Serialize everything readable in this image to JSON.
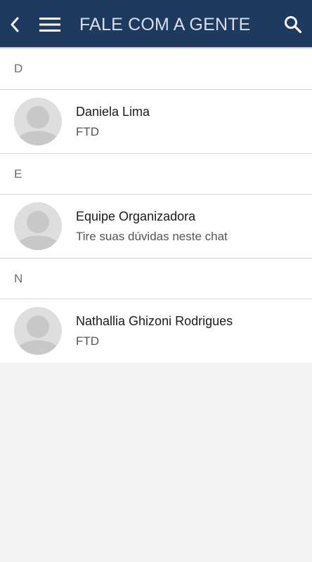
{
  "header": {
    "title": "FALE COM A GENTE",
    "back_icon": "chevron-left-icon",
    "menu_icon": "hamburger-menu-icon",
    "search_icon": "search-icon",
    "background_color": "#1e3a5f"
  },
  "sections": [
    {
      "letter": "D",
      "contacts": [
        {
          "name": "Daniela Lima",
          "subtitle": "FTD",
          "avatar": "default-user-avatar"
        }
      ]
    },
    {
      "letter": "E",
      "contacts": [
        {
          "name": "Equipe Organizadora",
          "subtitle": "Tire suas dúvidas neste chat",
          "avatar": "default-user-avatar"
        }
      ]
    },
    {
      "letter": "N",
      "contacts": [
        {
          "name": "Nathallia Ghizoni Rodrigues",
          "subtitle": "FTD",
          "avatar": "default-user-avatar"
        }
      ]
    }
  ]
}
